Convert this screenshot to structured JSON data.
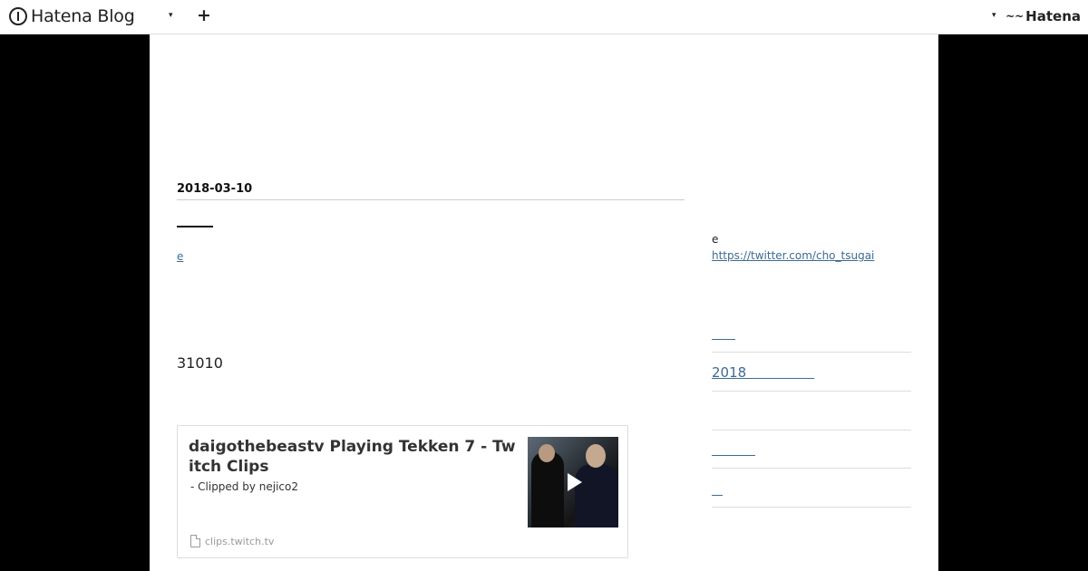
{
  "topbar": {
    "logo_text": "Hatena Blog",
    "caret_icon": "▾",
    "plus_icon": "+",
    "hatena_mark": "~~",
    "hatena_text": "Hatena"
  },
  "entry": {
    "date": "2018-03-10",
    "category_link": "e",
    "body_number": "31010"
  },
  "embed": {
    "title": "daigothebeastv Playing Tekken 7 - Twitch Clips",
    "description": " - Clipped by nejico2",
    "source": "clips.twitch.tv"
  },
  "sidebar": {
    "label_e": "e",
    "twitter_url": "https://twitter.com/cho_tsugai",
    "link_1": "　　",
    "link_2": "2018　　　　　",
    "link_3": "　　　　",
    "link_4": "　"
  }
}
